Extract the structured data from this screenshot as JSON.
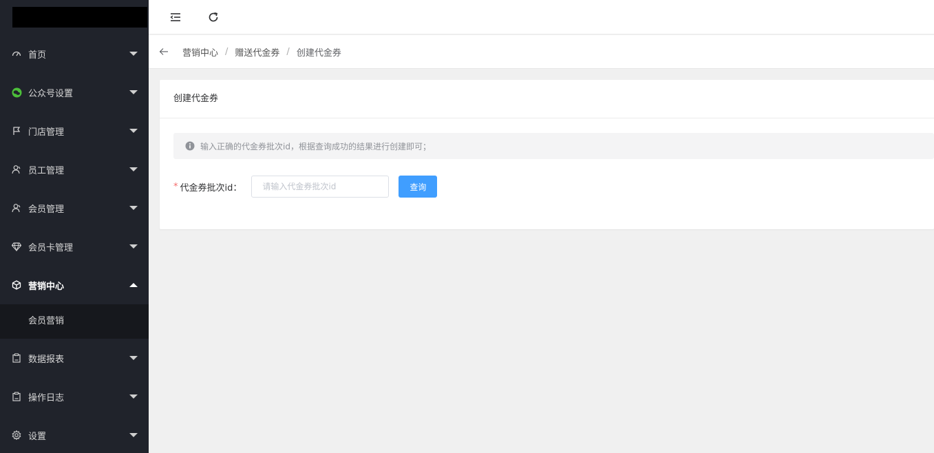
{
  "sidebar": {
    "items": [
      {
        "label": "首页",
        "icon": "dashboard-icon"
      },
      {
        "label": "公众号设置",
        "icon": "wechat-icon"
      },
      {
        "label": "门店管理",
        "icon": "flag-icon"
      },
      {
        "label": "员工管理",
        "icon": "user-icon"
      },
      {
        "label": "会员管理",
        "icon": "user-icon"
      },
      {
        "label": "会员卡管理",
        "icon": "diamond-icon"
      },
      {
        "label": "营销中心",
        "icon": "cube-icon"
      },
      {
        "label": "数据报表",
        "icon": "clipboard-icon"
      },
      {
        "label": "操作日志",
        "icon": "clipboard-icon"
      },
      {
        "label": "设置",
        "icon": "gear-icon"
      }
    ],
    "submenu": {
      "label": "会员营销"
    }
  },
  "breadcrumb": {
    "items": [
      "营销中心",
      "赠送代金券",
      "创建代金券"
    ],
    "separator": "/"
  },
  "card": {
    "title": "创建代金券",
    "alert_text": "输入正确的代金券批次id，根据查询成功的结果进行创建即可；",
    "form": {
      "required_mark": "*",
      "label": "代金券批次id：",
      "input_value": "",
      "input_placeholder": "请输入代金券批次id",
      "query_label": "查询"
    }
  },
  "colors": {
    "sidebar_bg": "#20232b",
    "submenu_bg": "#16181d",
    "primary": "#409eff",
    "wechat_green": "#4cbf3a"
  }
}
